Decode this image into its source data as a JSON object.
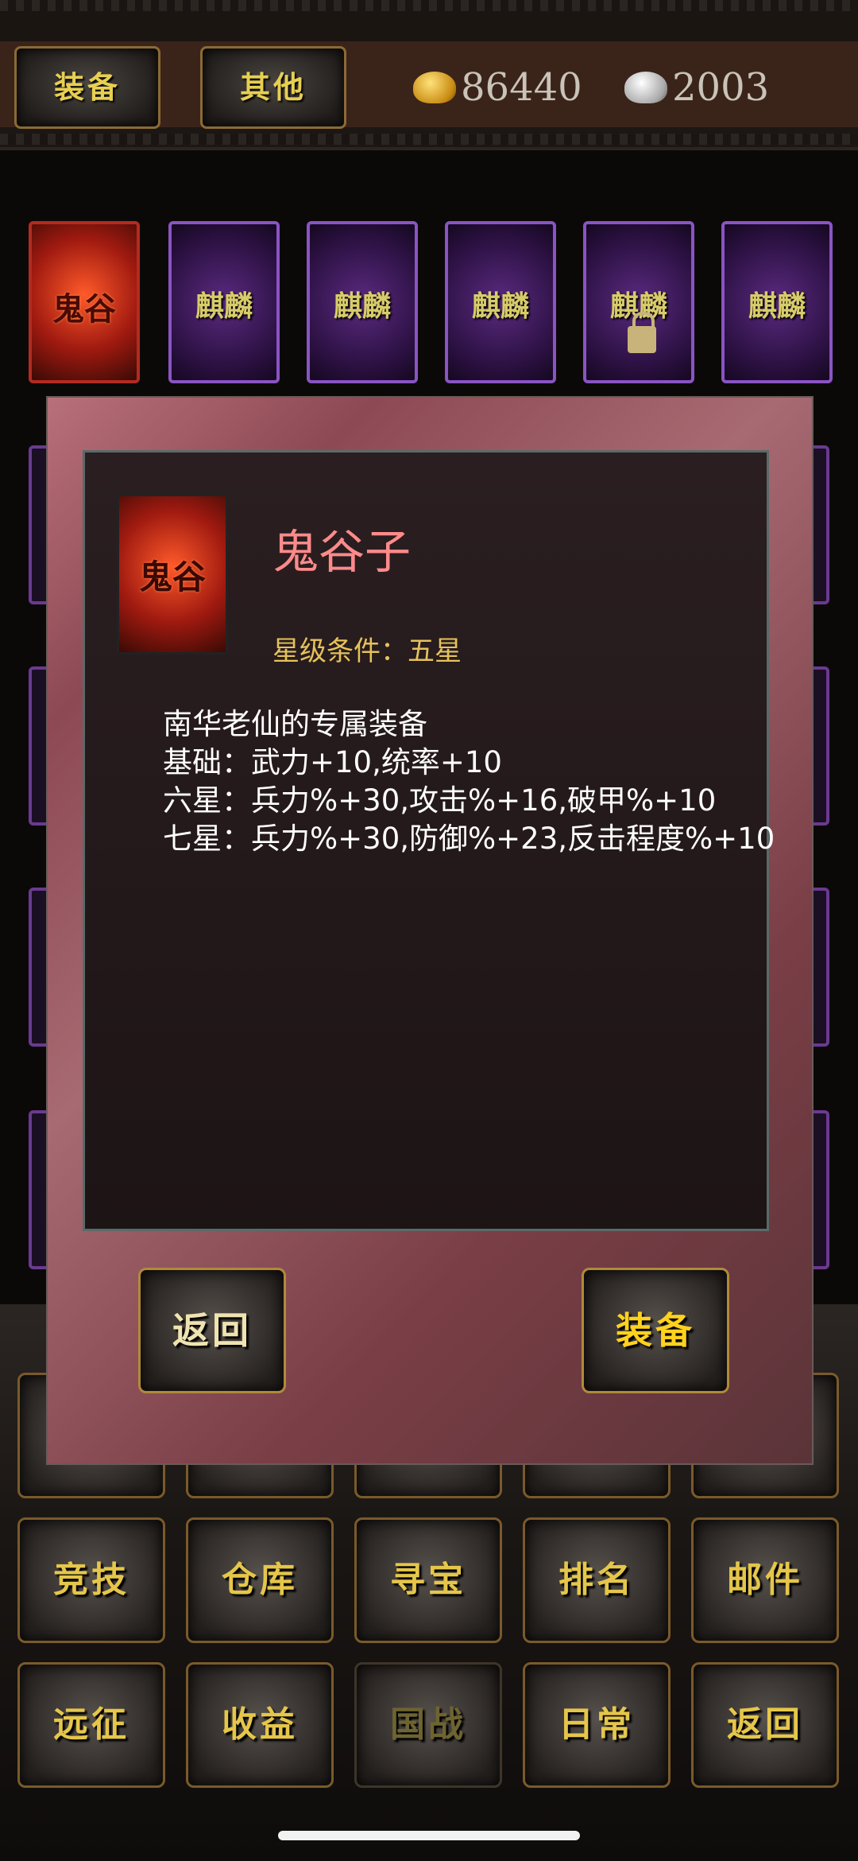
{
  "top": {
    "tabs": [
      "装备",
      "其他"
    ],
    "gold": "86440",
    "silver": "2003"
  },
  "cards": [
    {
      "label": "鬼谷",
      "style": "red"
    },
    {
      "label": "麒麟",
      "style": "purple"
    },
    {
      "label": "麒麟",
      "style": "purple"
    },
    {
      "label": "麒麟",
      "style": "purple"
    },
    {
      "label": "麒麟",
      "style": "purple",
      "locked": true
    },
    {
      "label": "麒麟",
      "style": "purple"
    }
  ],
  "modal": {
    "card_label": "鬼谷",
    "name": "鬼谷子",
    "star_req": "星级条件：五星",
    "desc": [
      "南华老仙的专属装备",
      "基础：武力+10,统率+10",
      "六星：兵力%+30,攻击%+16,破甲%+10",
      "七星：兵力%+30,防御%+23,反击程度%+10"
    ],
    "back_label": "返回",
    "equip_label": "装备"
  },
  "menu": {
    "row2": [
      "竞技",
      "仓库",
      "寻宝",
      "排名",
      "邮件"
    ],
    "row3": [
      "远征",
      "收益",
      "国战",
      "日常",
      "返回"
    ]
  },
  "colors": {
    "gold_text": "#e5c64a",
    "name_pink": "#ff8a8a",
    "star_yellow": "#e5c25a"
  }
}
